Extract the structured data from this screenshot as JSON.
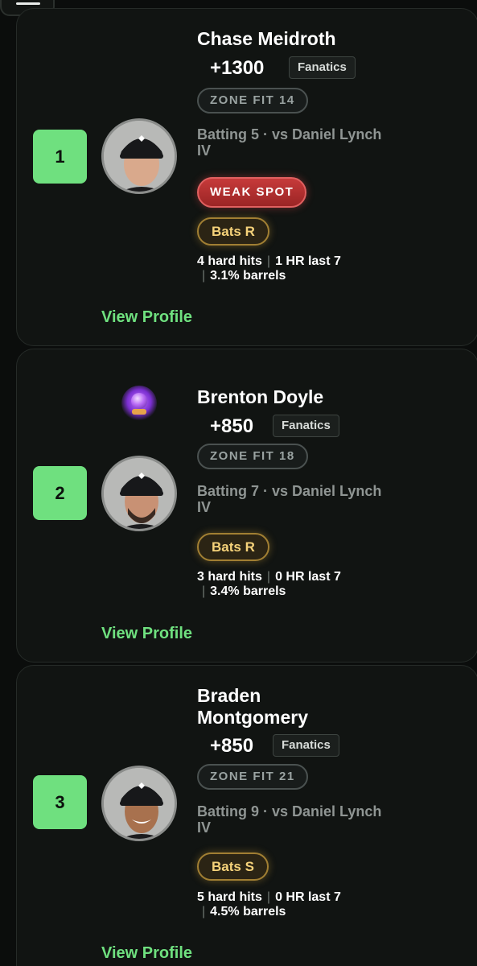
{
  "players": [
    {
      "rank": "1",
      "name": "Chase Meidroth",
      "odds": "+1300",
      "book": "Fanatics",
      "zone_fit": "ZONE FIT 14",
      "matchup": "Batting 5 · vs Daniel Lynch IV",
      "weak_spot": "WEAK SPOT",
      "bats": "Bats R",
      "stat_hard_hits": "4 hard hits",
      "stat_hr": "1 HR last 7",
      "stat_barrels": "3.1% barrels",
      "view_profile": "View Profile"
    },
    {
      "rank": "2",
      "name": "Brenton Doyle",
      "odds": "+850",
      "book": "Fanatics",
      "zone_fit": "ZONE FIT 18",
      "matchup": "Batting 7 · vs Daniel Lynch IV",
      "bats": "Bats R",
      "stat_hard_hits": "3 hard hits",
      "stat_hr": "0 HR last 7",
      "stat_barrels": "3.4% barrels",
      "view_profile": "View Profile",
      "badge_icon": "crystal-ball-icon"
    },
    {
      "rank": "3",
      "name": "Braden Montgomery",
      "odds": "+850",
      "book": "Fanatics",
      "zone_fit": "ZONE FIT 21",
      "matchup": "Batting 9 · vs Daniel Lynch IV",
      "bats": "Bats S",
      "stat_hard_hits": "5 hard hits",
      "stat_hr": "0 HR last 7",
      "stat_barrels": "4.5% barrels",
      "view_profile": "View Profile"
    }
  ],
  "colors": {
    "accent_green": "#6fe07f",
    "weak_red": "#c63a3a",
    "bats_gold": "#f5d27a",
    "background": "#0b0d0c"
  }
}
